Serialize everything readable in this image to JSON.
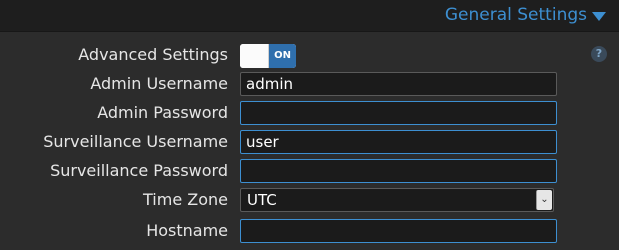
{
  "section": {
    "title": "General Settings",
    "expanded_icon": "caret-down-icon"
  },
  "help": {
    "glyph": "?",
    "icon": "help-icon"
  },
  "fields": {
    "advanced_settings": {
      "label": "Advanced Settings",
      "toggle_text": "ON",
      "enabled": true
    },
    "admin_username": {
      "label": "Admin Username",
      "value": "admin"
    },
    "admin_password": {
      "label": "Admin Password",
      "value": ""
    },
    "surveillance_username": {
      "label": "Surveillance Username",
      "value": "user"
    },
    "surveillance_password": {
      "label": "Surveillance Password",
      "value": ""
    },
    "time_zone": {
      "label": "Time Zone",
      "value": "UTC",
      "arrow_glyph": "⌄"
    },
    "hostname": {
      "label": "Hostname",
      "value": ""
    }
  },
  "colors": {
    "accent": "#3d8fd1",
    "background": "#2c2c2c",
    "header_background": "#1e1e1e",
    "toggle_on": "#2f6fad"
  }
}
